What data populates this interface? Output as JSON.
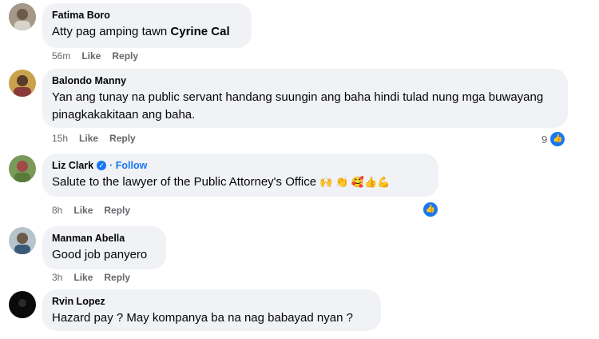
{
  "comments": [
    {
      "name": "Fatima Boro",
      "text_prefix": "Atty pag amping tawn ",
      "mention": "Cyrine Cal",
      "time": "56m",
      "like": "Like",
      "reply": "Reply"
    },
    {
      "name": "Balondo Manny",
      "text": "Yan ang tunay na public servant handang suungin ang baha hindi tulad nung mga buwayang pinagkakakitaan ang baha.",
      "time": "15h",
      "like": "Like",
      "reply": "Reply",
      "reaction_count": "9"
    },
    {
      "name": "Liz Clark",
      "follow": "· Follow",
      "text": "Salute to the lawyer of the Public Attorney's Office",
      "emojis": "🙌 👏 🥰👍💪",
      "time": "8h",
      "like": "Like",
      "reply": "Reply"
    },
    {
      "name": "Manman Abella",
      "text": "Good job panyero",
      "time": "3h",
      "like": "Like",
      "reply": "Reply"
    },
    {
      "name": "Rvin Lopez",
      "text": "Hazard pay ? May kompanya ba na nag babayad nyan ?"
    }
  ],
  "colors": {
    "bubble": "#f0f2f5",
    "meta": "#65676b",
    "accent": "#1877f2"
  }
}
